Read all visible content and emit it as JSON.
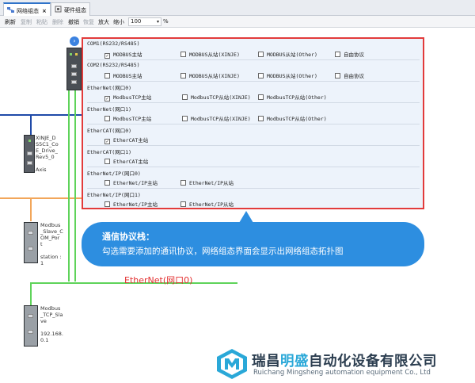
{
  "tabs": [
    {
      "label": "网络组态",
      "active": true,
      "close": "×"
    },
    {
      "label": "硬件组态",
      "active": false
    }
  ],
  "toolbar": {
    "refresh": "刷新",
    "copy": "复制",
    "paste": "粘贴",
    "delete": "删除",
    "undo": "撤销",
    "redo": "恢复",
    "zoom_in": "放大",
    "zoom_out": "缩小",
    "zoom_value": "100",
    "zoom_arrow": "▾",
    "zoom_unit": "%"
  },
  "devices": {
    "axis": {
      "label": "XINJE_D\nS5C1_Co\nE_Drive_\nRev5_0\n\nAxis"
    },
    "modbus_port": {
      "label": "Modbus\n_Slave_C\nOM_Por\nt\n\nstation :\n1"
    },
    "modbus_tcp": {
      "label": "Modbus\n_TCP_Sla\nve\n\n192.168.\n0.1"
    }
  },
  "expand_button": "›",
  "protocols": {
    "com1": {
      "title": "COM1(RS232/RS485)",
      "options": [
        {
          "label": "MODBUS主站",
          "checked": true
        },
        {
          "label": "MODBUS从站(XINJE)",
          "checked": false
        },
        {
          "label": "MODBUS从站(Other)",
          "checked": false
        },
        {
          "label": "自由协议",
          "checked": false
        }
      ]
    },
    "com2": {
      "title": "COM2(RS232/RS485)",
      "options": [
        {
          "label": "MODBUS主站",
          "checked": false
        },
        {
          "label": "MODBUS从站(XINJE)",
          "checked": false
        },
        {
          "label": "MODBUS从站(Other)",
          "checked": false
        },
        {
          "label": "自由协议",
          "checked": false
        }
      ]
    },
    "eth0": {
      "title": "EtherNet(网口0)",
      "options": [
        {
          "label": "ModbusTCP主站",
          "checked": true
        },
        {
          "label": "ModbusTCP从站(XINJE)",
          "checked": false
        },
        {
          "label": "ModbusTCP从站(Other)",
          "checked": false
        }
      ]
    },
    "eth1": {
      "title": "EtherNet(网口1)",
      "options": [
        {
          "label": "ModbusTCP主站",
          "checked": false
        },
        {
          "label": "ModbusTCP从站(XINJE)",
          "checked": false
        },
        {
          "label": "ModbusTCP从站(Other)",
          "checked": false
        }
      ]
    },
    "ecat0": {
      "title": "EtherCAT(网口0)",
      "options": [
        {
          "label": "EtherCAT主站",
          "checked": true
        }
      ]
    },
    "ecat1": {
      "title": "EtherCAT(网口1)",
      "options": [
        {
          "label": "EtherCAT主站",
          "checked": false
        }
      ]
    },
    "eip0": {
      "title": "EtherNet/IP(网口0)",
      "options": [
        {
          "label": "EtherNet/IP主站",
          "checked": false
        },
        {
          "label": "EtherNet/IP从站",
          "checked": false
        }
      ]
    },
    "eip1": {
      "title": "EtherNet/IP(网口1)",
      "options": [
        {
          "label": "EtherNet/IP主站",
          "checked": false
        },
        {
          "label": "EtherNet/IP从站",
          "checked": false
        }
      ]
    }
  },
  "callout": {
    "title": "通信协议栈：",
    "text": "勾选需要添加的通讯协议，网络组态界面会显示出网络组态拓扑图"
  },
  "ethernet_label": "EtherNet(网口0)",
  "company": {
    "name_part1": "瑞昌",
    "name_highlight": "明盛",
    "name_part2": "自动化设备有限公司",
    "name_en": "Ruichang Mingsheng automation equipment Co., Ltd"
  },
  "colors": {
    "panel_border": "#e23b3b",
    "panel_bg": "#edf3fb",
    "callout": "#2d8ee0",
    "wire_blue": "#1f4aa8",
    "wire_green": "#5fd35a",
    "wire_orange": "#f2a65a",
    "ethernet_red": "#e33030"
  }
}
